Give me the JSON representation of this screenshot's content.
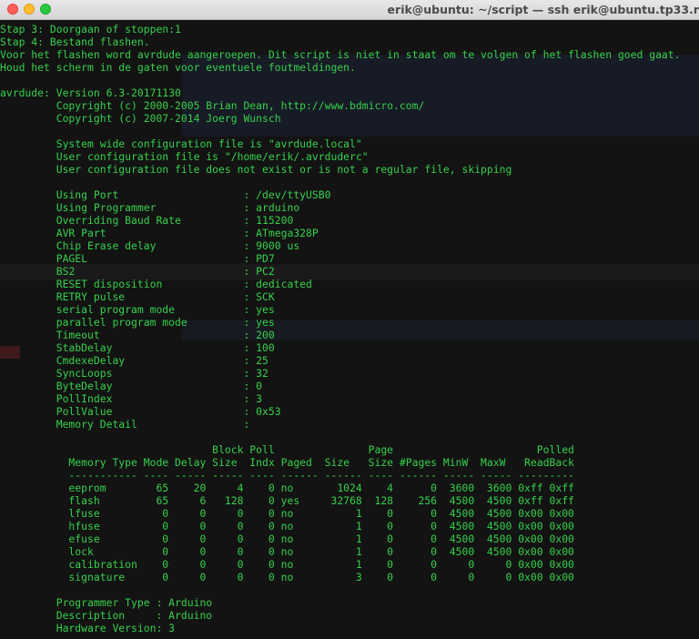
{
  "window": {
    "title": "erik@ubuntu: ~/script — ssh erik@ubuntu.tp33.r"
  },
  "colors": {
    "terminal_text": "#37d04b",
    "terminal_background": "#131313",
    "close": "#fe5f57",
    "minimize": "#febc2e",
    "maximize": "#28c840"
  },
  "terminal": {
    "lines": [
      "Stap 3: Doorgaan of stoppen:1",
      "Stap 4: Bestand flashen.",
      "Voor het flashen word avrdude aangeroepen. Dit script is niet in staat om te volgen of het flashen goed gaat.",
      "Houd het scherm in de gaten voor eventuele foutmeldingen.",
      "",
      "avrdude: Version 6.3-20171130",
      "         Copyright (c) 2000-2005 Brian Dean, http://www.bdmicro.com/",
      "         Copyright (c) 2007-2014 Joerg Wunsch",
      "",
      "         System wide configuration file is \"avrdude.local\"",
      "         User configuration file is \"/home/erik/.avrduderc\"",
      "         User configuration file does not exist or is not a regular file, skipping",
      "",
      "         Using Port                    : /dev/ttyUSB0",
      "         Using Programmer              : arduino",
      "         Overriding Baud Rate          : 115200",
      "         AVR Part                      : ATmega328P",
      "         Chip Erase delay              : 9000 us",
      "         PAGEL                         : PD7",
      "         BS2                           : PC2",
      "         RESET disposition             : dedicated",
      "         RETRY pulse                   : SCK",
      "         serial program mode           : yes",
      "         parallel program mode         : yes",
      "         Timeout                       : 200",
      "         StabDelay                     : 100",
      "         CmdexeDelay                   : 25",
      "         SyncLoops                     : 32",
      "         ByteDelay                     : 0",
      "         PollIndex                     : 3",
      "         PollValue                     : 0x53",
      "         Memory Detail                 :",
      "",
      "                                  Block Poll               Page                       Polled",
      "           Memory Type Mode Delay Size  Indx Paged  Size   Size #Pages MinW  MaxW   ReadBack",
      "           ----------- ---- ----- ----- ---- ------ ------ ---- ------ ----- ----- ---------",
      "           eeprom        65    20     4    0 no       1024    4      0  3600  3600 0xff 0xff",
      "           flash         65     6   128    0 yes     32768  128    256  4500  4500 0xff 0xff",
      "           lfuse          0     0     0    0 no          1    0      0  4500  4500 0x00 0x00",
      "           hfuse          0     0     0    0 no          1    0      0  4500  4500 0x00 0x00",
      "           efuse          0     0     0    0 no          1    0      0  4500  4500 0x00 0x00",
      "           lock           0     0     0    0 no          1    0      0  4500  4500 0x00 0x00",
      "           calibration    0     0     0    0 no          1    0      0     0     0 0x00 0x00",
      "           signature      0     0     0    0 no          3    0      0     0     0 0x00 0x00",
      "",
      "         Programmer Type : Arduino",
      "         Description     : Arduino",
      "         Hardware Version: 3"
    ]
  }
}
